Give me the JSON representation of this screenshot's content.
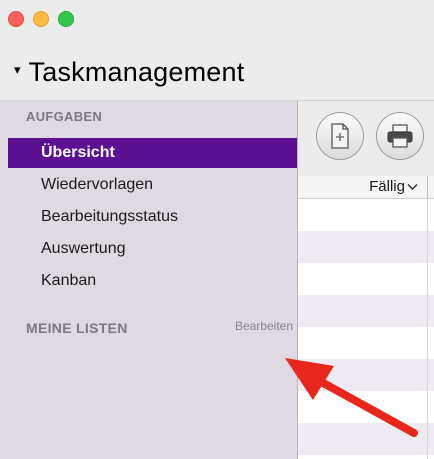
{
  "window": {
    "title": "Taskmanagement",
    "title_caret": "▾"
  },
  "sidebar": {
    "section_tasks": "AUFGABEN",
    "items": [
      {
        "label": "Übersicht",
        "selected": true
      },
      {
        "label": "Wiedervorlagen",
        "selected": false
      },
      {
        "label": "Bearbeitungsstatus",
        "selected": false
      },
      {
        "label": "Auswertung",
        "selected": false
      },
      {
        "label": "Kanban",
        "selected": false
      }
    ],
    "section_lists": "MEINE LISTEN",
    "edit_label": "Bearbeiten"
  },
  "table": {
    "columns": [
      {
        "label": "Fällig",
        "sort_icon": "chevron-down-icon"
      }
    ]
  },
  "toolbar": {
    "buttons": [
      {
        "icon": "document-icon"
      },
      {
        "icon": "printer-icon"
      }
    ]
  },
  "colors": {
    "selection": "#5b1191",
    "sidebar_bg": "#dfd9e2",
    "annotation_arrow": "#e8261c"
  }
}
